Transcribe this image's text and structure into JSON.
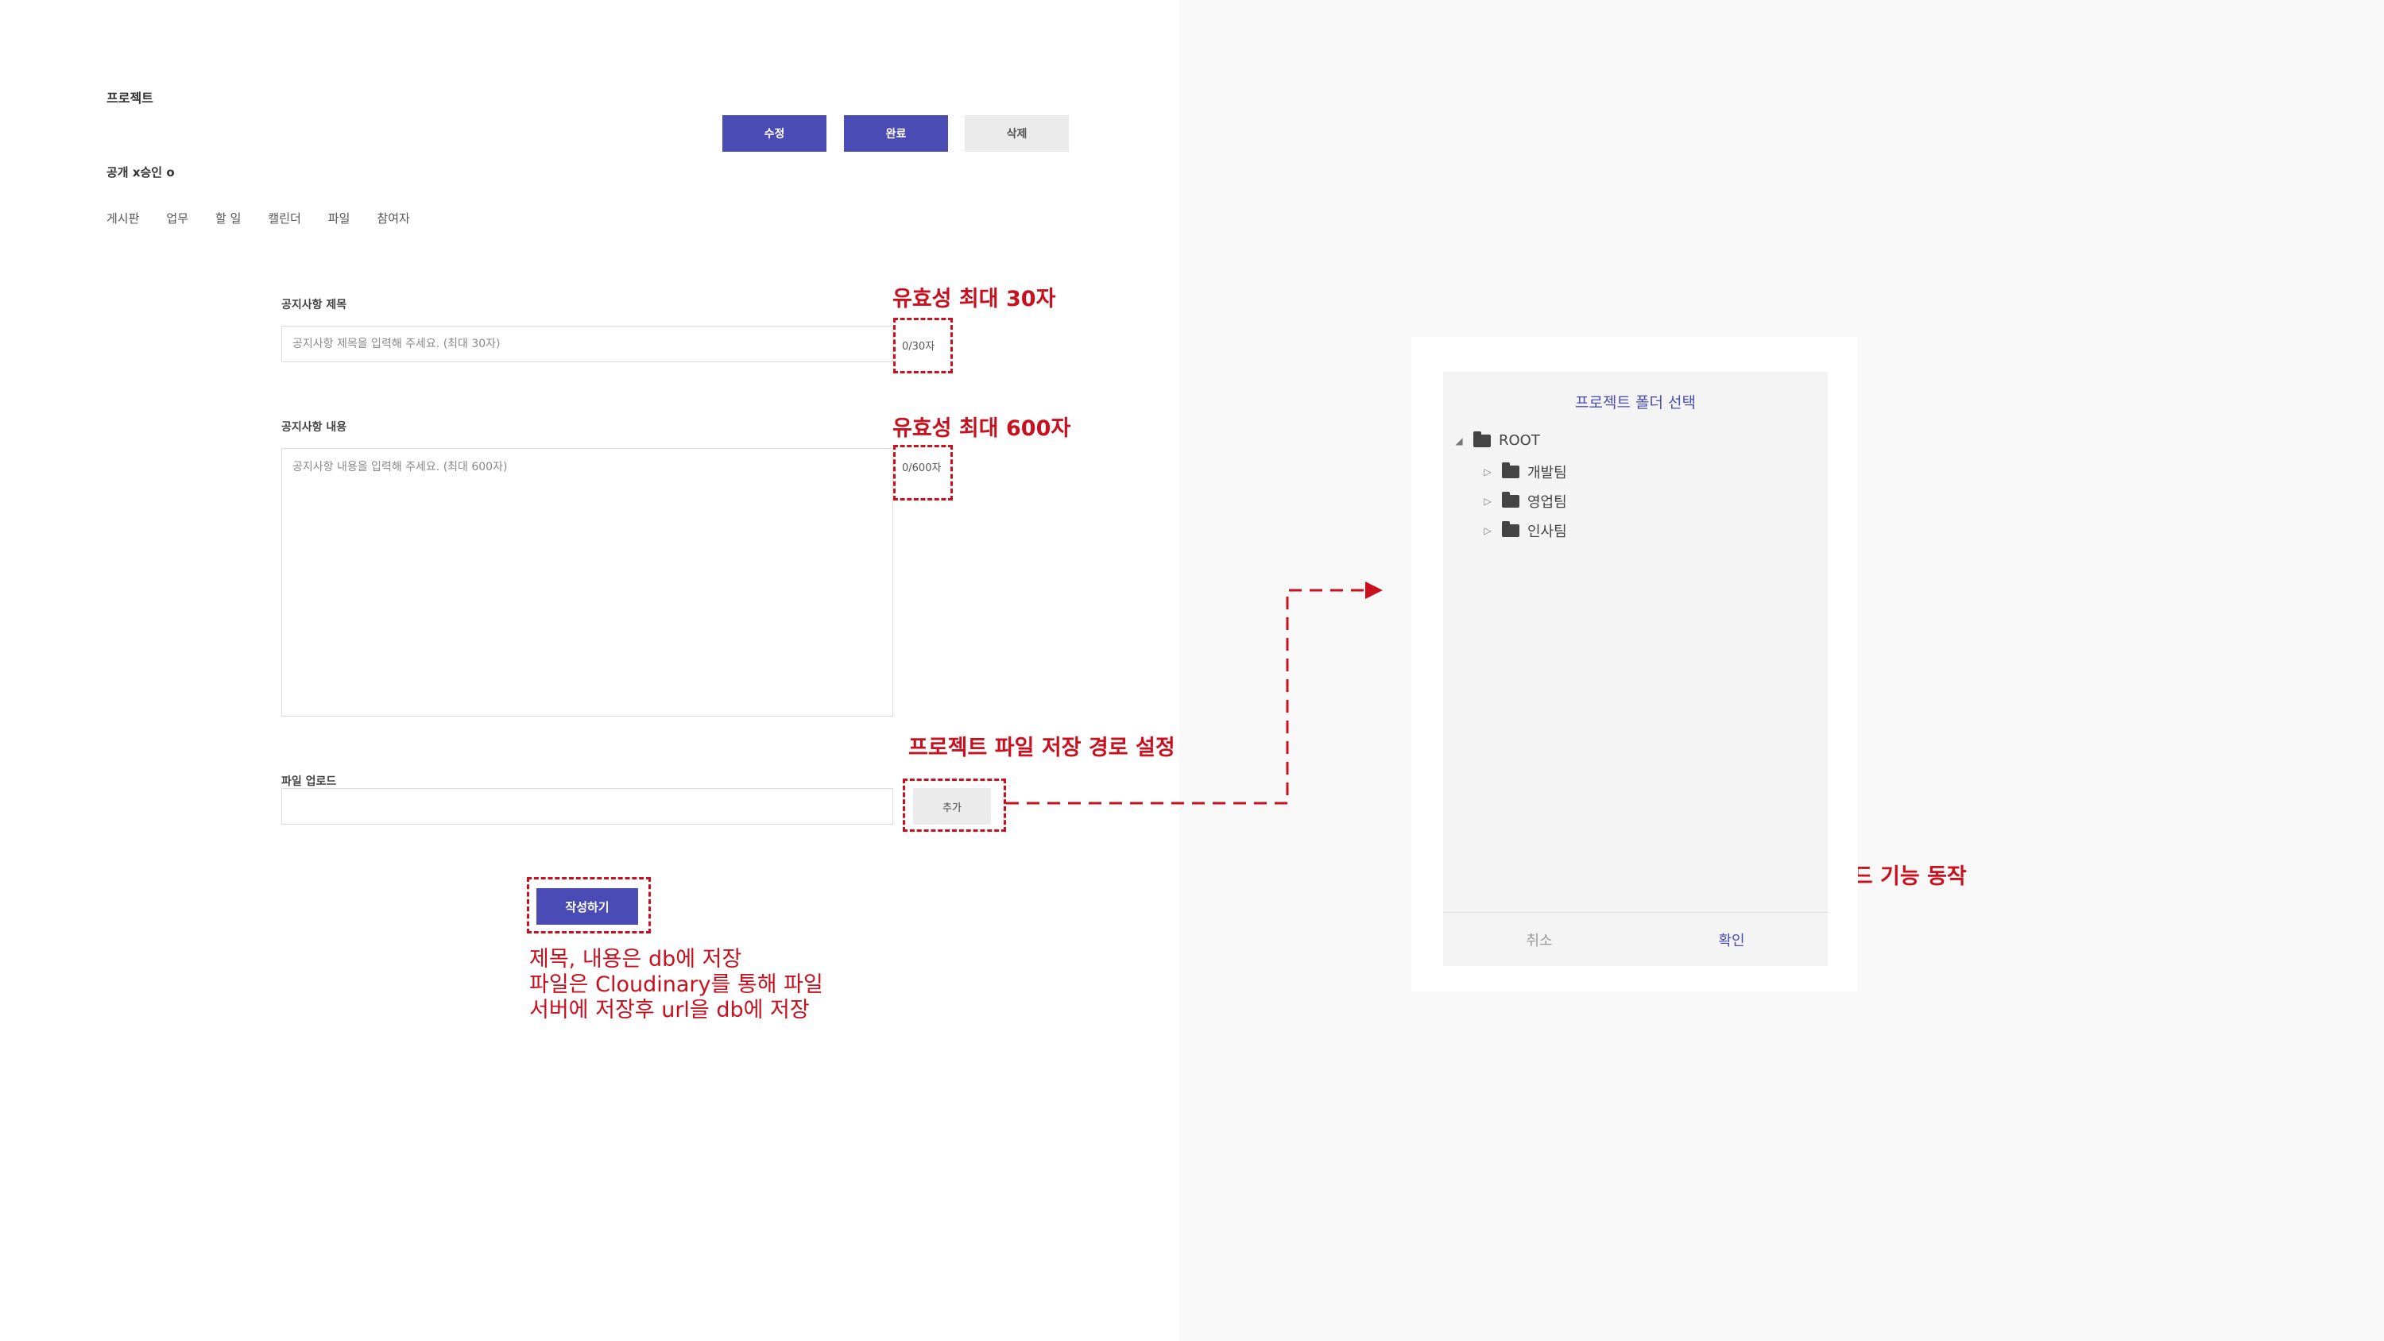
{
  "header": {
    "title": "프로젝트",
    "status": "공개 x승인 o",
    "buttons": {
      "edit": "수정",
      "complete": "완료",
      "delete": "삭제"
    }
  },
  "tabs": [
    "게시판",
    "업무",
    "할 일",
    "캘린더",
    "파일",
    "참여자"
  ],
  "form": {
    "title_label": "공지사항 제목",
    "title_placeholder": "공지사항 제목을 입력해 주세요. (최대 30자)",
    "title_counter": "0/30자",
    "content_label": "공지사항 내용",
    "content_placeholder": "공지사항 내용을 입력해 주세요. (최대 600자)",
    "content_counter": "0/600자",
    "file_label": "파일 업로드",
    "add_button": "추가",
    "submit_button": "작성하기"
  },
  "annotations": {
    "title_validation": "유효성 최대 30자",
    "content_validation": "유효성 최대 600자",
    "file_path": "프로젝트 파일 저장 경로 설정",
    "submit_note": [
      "제목, 내용은 db에 저장",
      "파일은 Cloudinary를 통해 파일",
      "서버에 저장후 url을 db에 저장"
    ],
    "confirm_note": "확인 클릭시 파일 업로드 기능 동작"
  },
  "modal": {
    "title": "프로젝트 폴더 선택",
    "root": "ROOT",
    "folders": [
      "개발팀",
      "영업팀",
      "인사팀"
    ],
    "cancel": "취소",
    "confirm": "확인"
  },
  "colors": {
    "primary": "#4b4bb5",
    "annotation": "#c8101e"
  }
}
